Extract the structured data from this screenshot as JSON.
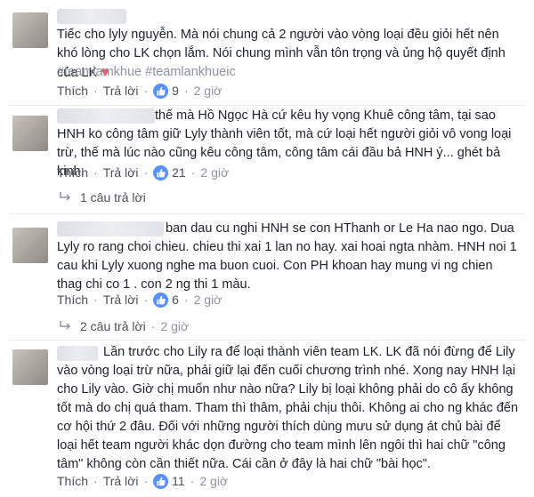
{
  "comments": [
    {
      "text": "Tiếc cho lyly nguyễn. Mà nói chung cả 2 người vào vòng loại đều giỏi hết nên khó lòng cho LK chọn lắm. Nói chung mình vẫn tôn trọng và ủng hộ quyết định của LK",
      "heart": "♥",
      "tags": "#teamlamkhue #teamlankhueic",
      "like_label": "Thích",
      "reply_label": "Trả lời",
      "likes": "9",
      "time": "2 giờ"
    },
    {
      "text": "thế mà Hồ Ngọc Hà cứ kêu hy vọng Khuê công tâm, tại sao HNH ko công tâm giữ Lyly thành viên tốt, mà cứ loại hết người giỏi vô vong loại trừ, thế mà lúc nào cũng kêu công tâm, công tâm cái đầu bả HNH ý... ghét bả kinh.",
      "like_label": "Thích",
      "reply_label": "Trả lời",
      "likes": "21",
      "time": "2 giờ",
      "replies_label": "1 câu trả lời"
    },
    {
      "text": "ban dau cu nghi HNH se con HThanh or Le Ha nao ngo. Dua Lyly ro rang choi chieu. chieu thi xai 1 lan no hay. xai hoai ngta nhàm. HNH noi 1 cau khi Lyly xuong nghe ma buon cuoi. Con PH khoan hay mung vi ng chien thag chi co 1 . con 2 ng thi 1 màu.",
      "like_label": "Thích",
      "reply_label": "Trả lời",
      "likes": "6",
      "time": "2 giờ",
      "replies_label": "2 câu trả lời",
      "replies_time": "2 giờ"
    },
    {
      "text": "Lần trước cho Lily ra để loại thành viên team LK. LK đã nói đừng để Lily vào vòng loại trừ nữa, phải giữ lại đến cuối chương trình nhé. Xong nay HNH lại cho Lily vào. Giờ chị muốn như nào nữa? Lily bị loại không phải do cô ấy không tốt mà do chị quá tham. Tham thì thâm, phải chịu thôi. Không ai cho ng khác đến cơ hội thứ 2 đâu. Đối với những người thích dùng mưu sử dụng át chủ bài để loại hết team người khác dọn đường cho team mình lên ngôi thì hai chữ \"công tâm\" không còn cần thiết nữa. Cái cần ở đây là hai chữ \"bài học\".",
      "like_label": "Thích",
      "reply_label": "Trả lời",
      "likes": "11",
      "time": "2 giờ"
    }
  ],
  "colors": {
    "link": "#4b4f56",
    "meta": "#90949c",
    "like_blue": "#5890ff",
    "heart": "#f25268"
  },
  "icons": {
    "like": "thumbs-up-icon",
    "reply": "reply-arrow-icon",
    "heart": "heart-icon"
  }
}
